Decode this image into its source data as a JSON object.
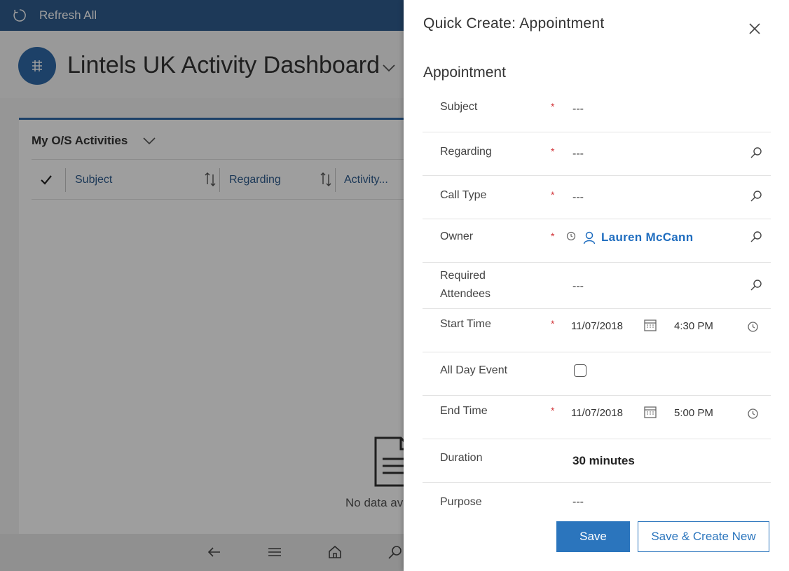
{
  "cmdbar": {
    "refresh_label": "Refresh All"
  },
  "header": {
    "title": "Lintels UK Activity Dashboard"
  },
  "panel": {
    "view_title": "My O/S Activities",
    "columns": [
      "Subject",
      "Regarding",
      "Activity..."
    ],
    "empty_text": "No data av"
  },
  "quick_create": {
    "title": "Quick Create: Appointment",
    "section": "Appointment",
    "fields": {
      "subject": {
        "label": "Subject",
        "required": "*",
        "value": "---"
      },
      "regarding": {
        "label": "Regarding",
        "required": "*",
        "value": "---"
      },
      "call_type": {
        "label": "Call Type",
        "required": "*",
        "value": "---"
      },
      "owner": {
        "label": "Owner",
        "required": "*",
        "value": "Lauren McCann"
      },
      "required_attendees": {
        "label_line1": "Required",
        "label_line2": "Attendees",
        "value": "---"
      },
      "start_time": {
        "label": "Start Time",
        "required": "*",
        "date": "11/07/2018",
        "time": "4:30 PM"
      },
      "all_day_event": {
        "label": "All Day Event",
        "checked": false
      },
      "end_time": {
        "label": "End Time",
        "required": "*",
        "date": "11/07/2018",
        "time": "5:00 PM"
      },
      "duration": {
        "label": "Duration",
        "value": "30 minutes"
      },
      "purpose": {
        "label": "Purpose",
        "value": "---"
      }
    },
    "buttons": {
      "save": "Save",
      "save_new": "Save & Create New"
    }
  },
  "colors": {
    "brand": "#2f5d8f",
    "accent": "#2b75bd",
    "required": "#d13438",
    "link": "#1f6dbf"
  }
}
